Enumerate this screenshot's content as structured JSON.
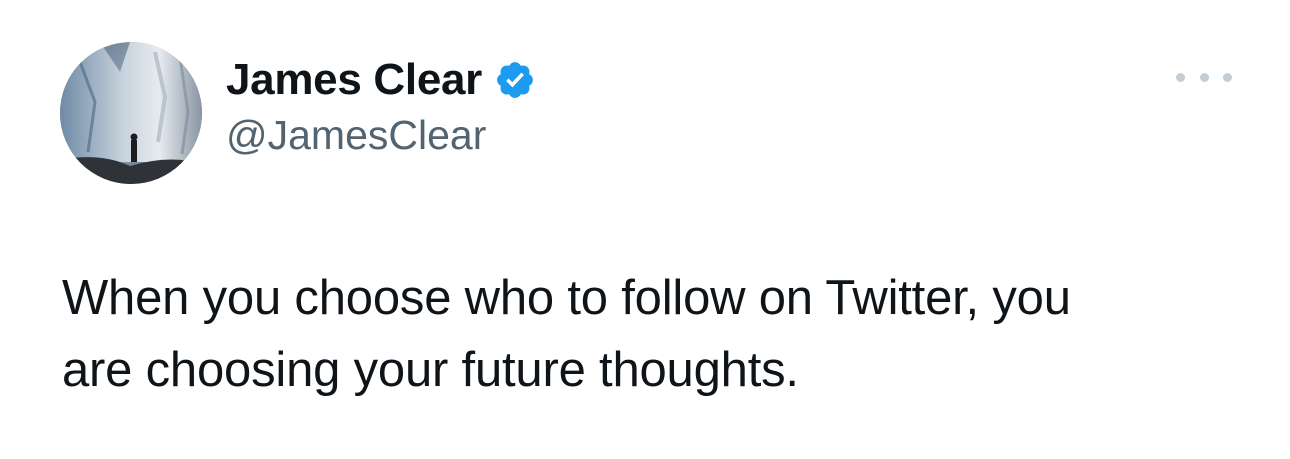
{
  "tweet": {
    "author": {
      "display_name": "James Clear",
      "handle": "@JamesClear",
      "verified": true,
      "verified_color": "#1d9bf0",
      "avatar": "avatar-photo"
    },
    "more_icon": "more-options-icon",
    "text_lines": [
      "When you choose who to follow on Twitter, you",
      "are choosing your future thoughts."
    ]
  },
  "colors": {
    "primary_text": "#0f1419",
    "secondary_text": "#536471",
    "background": "#ffffff"
  }
}
